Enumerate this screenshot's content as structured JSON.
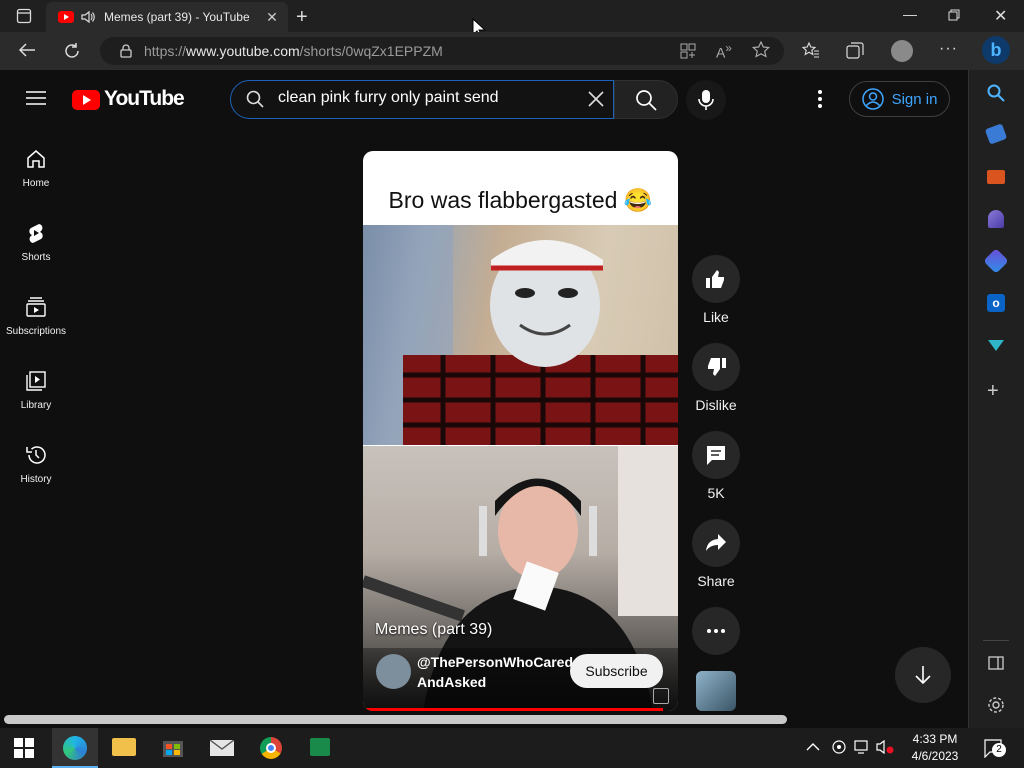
{
  "browser": {
    "tab_title": "Memes (part 39) - YouTube",
    "url_prefix": "https://",
    "url_host": "www.youtube.com",
    "url_path": "/shorts/0wqZx1EPPZM"
  },
  "youtube": {
    "logo_text": "YouTube",
    "search_query": "clean pink furry only paint send",
    "signin_label": "Sign in"
  },
  "nav": {
    "items": [
      {
        "label": "Home",
        "icon": "home-icon"
      },
      {
        "label": "Shorts",
        "icon": "shorts-icon"
      },
      {
        "label": "Subscriptions",
        "icon": "subscriptions-icon"
      },
      {
        "label": "Library",
        "icon": "library-icon"
      },
      {
        "label": "History",
        "icon": "history-icon"
      }
    ]
  },
  "short": {
    "caption": "Bro was flabbergasted 😂",
    "title": "Memes (part 39)",
    "channel_line1": "@ThePersonWhoCared",
    "channel_line2": "AndAsked",
    "subscribe_label": "Subscribe"
  },
  "actions": {
    "like": "Like",
    "dislike": "Dislike",
    "comments": "5K",
    "share": "Share"
  },
  "taskbar": {
    "time": "4:33 PM",
    "date": "4/6/2023",
    "notification_count": "2"
  },
  "colors": {
    "youtube_red": "#ff0000",
    "link_blue": "#3ea6ff",
    "search_focus": "#1c62b9"
  }
}
